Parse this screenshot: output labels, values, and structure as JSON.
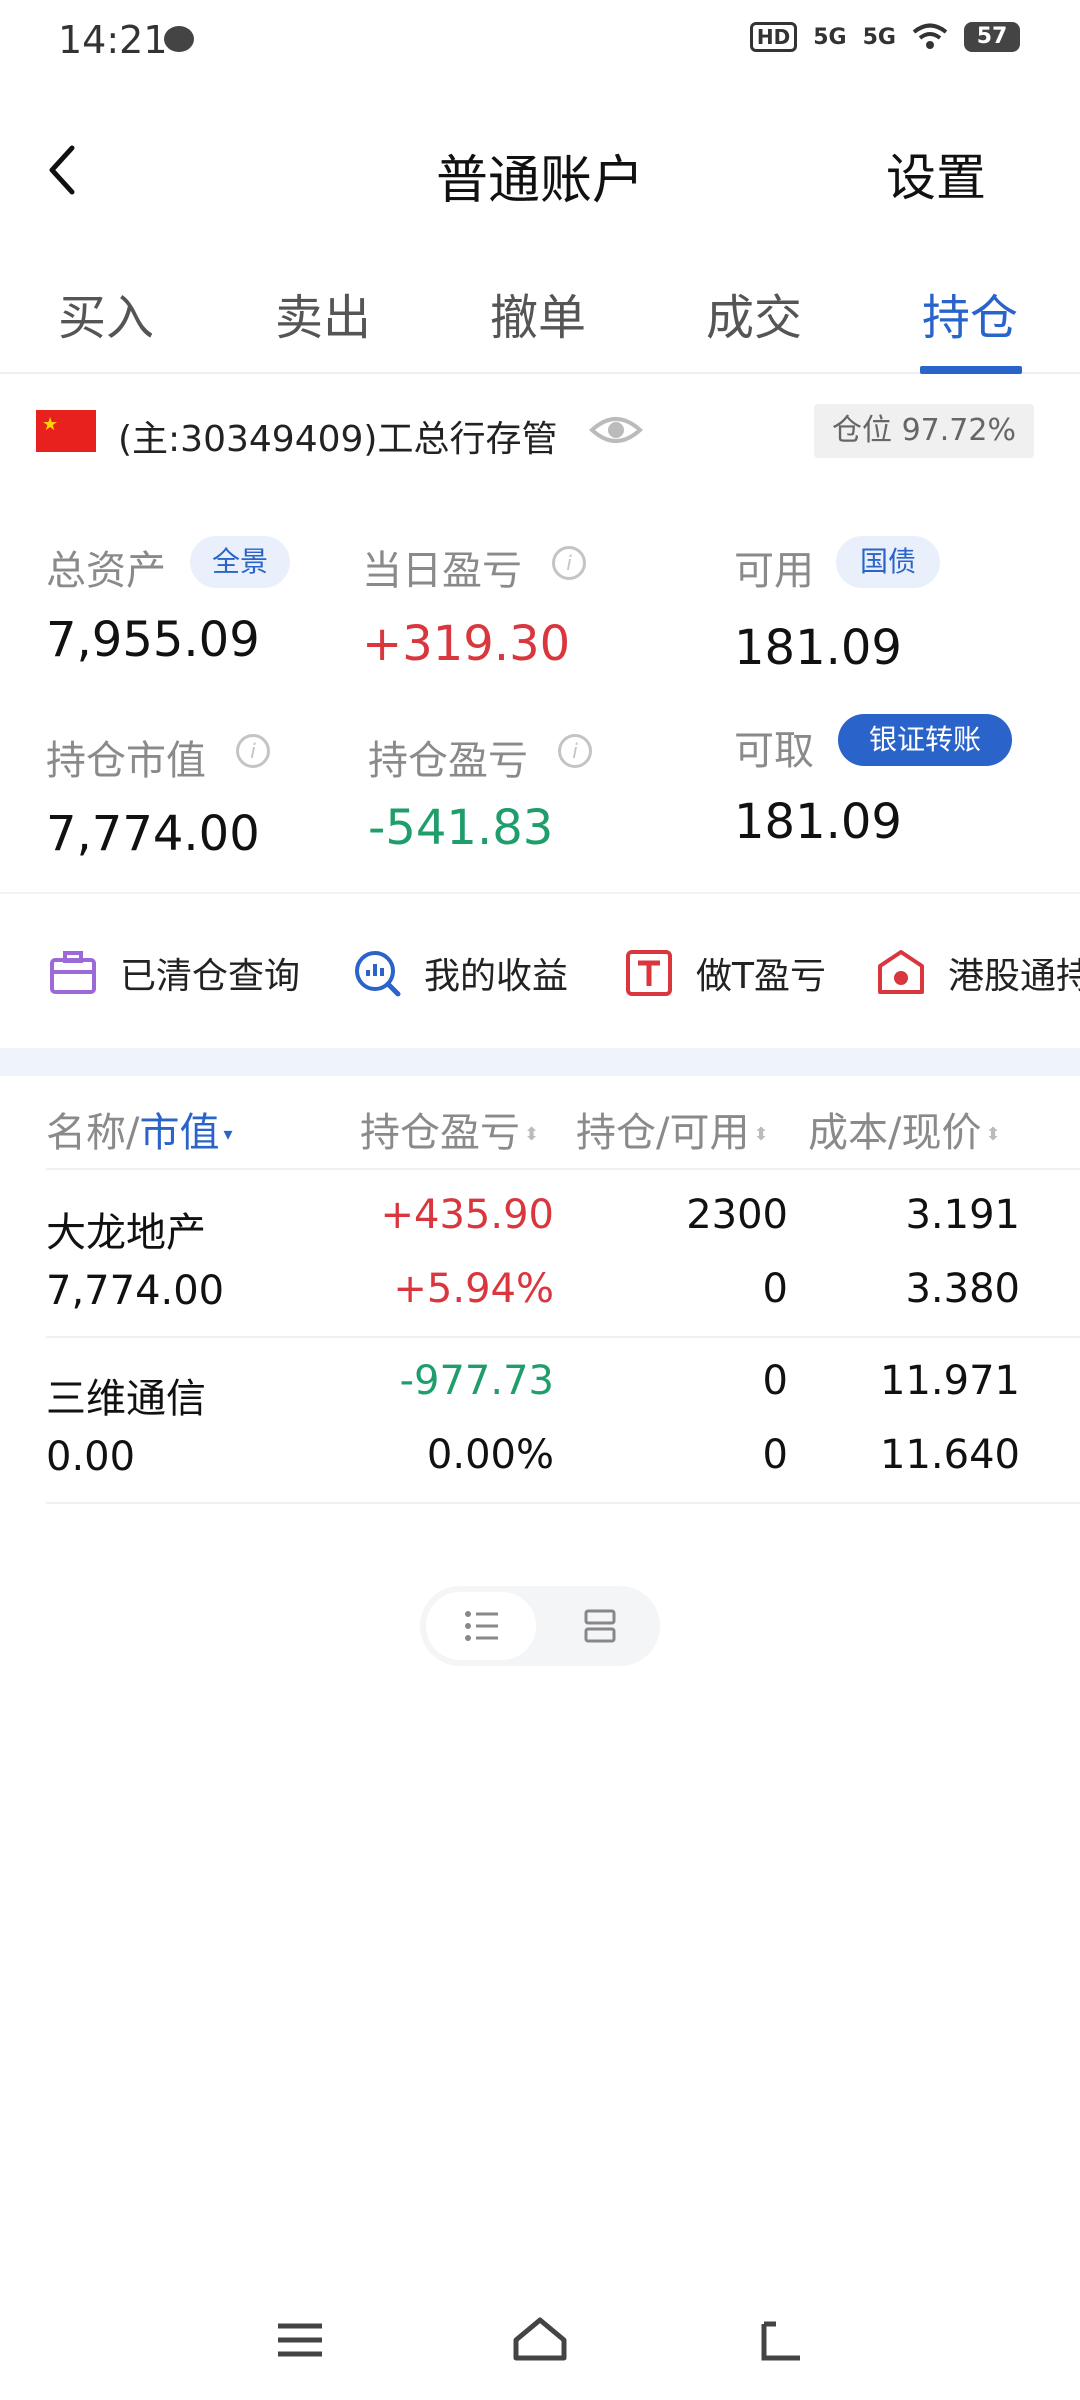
{
  "status_bar": {
    "time": "14:21",
    "hd": "HD",
    "signal1": "5G",
    "signal2": "5G",
    "battery": "57"
  },
  "header": {
    "title": "普通账户",
    "settings_label": "设置"
  },
  "tabs": [
    {
      "label": "买入",
      "active": false
    },
    {
      "label": "卖出",
      "active": false
    },
    {
      "label": "撤单",
      "active": false
    },
    {
      "label": "成交",
      "active": false
    },
    {
      "label": "持仓",
      "active": true
    }
  ],
  "account": {
    "name": "(主:30349409)工总行存管",
    "position_ratio": "仓位 97.72%"
  },
  "assets": {
    "total_label": "总资产",
    "total_badge": "全景",
    "total_value": "7,955.09",
    "daily_pl_label": "当日盈亏",
    "daily_pl_value": "+319.30",
    "available_label": "可用",
    "available_badge": "国债",
    "available_value": "181.09",
    "market_value_label": "持仓市值",
    "market_value": "7,774.00",
    "position_pl_label": "持仓盈亏",
    "position_pl_value": "-541.83",
    "withdrawable_label": "可取",
    "transfer_button": "银证转账",
    "withdrawable_value": "181.09"
  },
  "shortcuts": [
    {
      "label": "已清仓查询",
      "icon": "briefcase-icon"
    },
    {
      "label": "我的收益",
      "icon": "chart-search-icon"
    },
    {
      "label": "做T盈亏",
      "icon": "t-letter-icon"
    },
    {
      "label": "港股通持",
      "icon": "hk-flower-icon"
    }
  ],
  "table": {
    "headers": {
      "name_part1": "名称/",
      "name_part2": "市值",
      "pl": "持仓盈亏",
      "holding": "持仓/可用",
      "cost": "成本/现价"
    },
    "rows": [
      {
        "name": "大龙地产",
        "market_value": "7,774.00",
        "pl": "+435.90",
        "pl_pct": "+5.94%",
        "holding": "2300",
        "available": "0",
        "cost": "3.191",
        "price": "3.380"
      },
      {
        "name": "三维通信",
        "market_value": "0.00",
        "pl": "-977.73",
        "pl_pct": "0.00%",
        "holding": "0",
        "available": "0",
        "cost": "11.971",
        "price": "11.640"
      }
    ]
  },
  "colors": {
    "accent": "#2a63c9",
    "gain": "#d9363e",
    "loss": "#1f9d6a"
  }
}
